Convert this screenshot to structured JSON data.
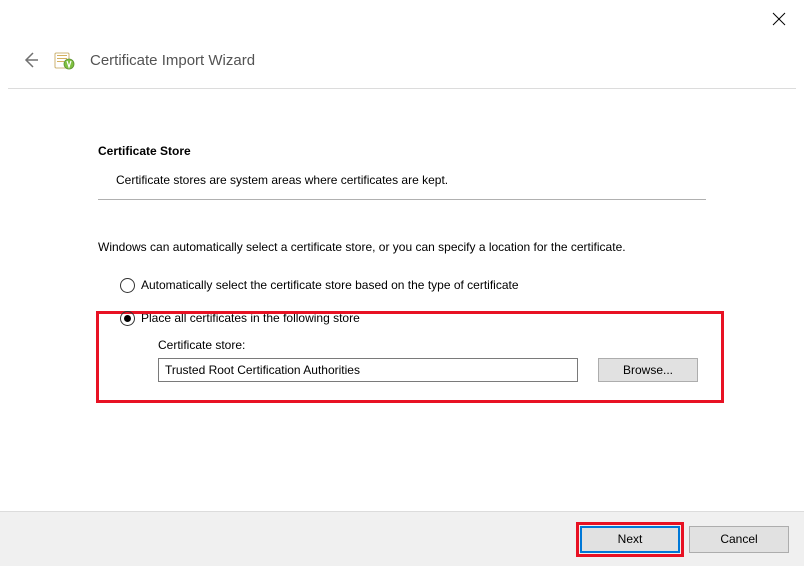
{
  "title": "Certificate Import Wizard",
  "section": {
    "heading": "Certificate Store",
    "description": "Certificate stores are system areas where certificates are kept.",
    "instruction": "Windows can automatically select a certificate store, or you can specify a location for the certificate."
  },
  "options": {
    "auto": "Automatically select the certificate store based on the type of certificate",
    "manual": "Place all certificates in the following store"
  },
  "store": {
    "label": "Certificate store:",
    "value": "Trusted Root Certification Authorities",
    "browse": "Browse..."
  },
  "footer": {
    "next": "Next",
    "cancel": "Cancel"
  }
}
